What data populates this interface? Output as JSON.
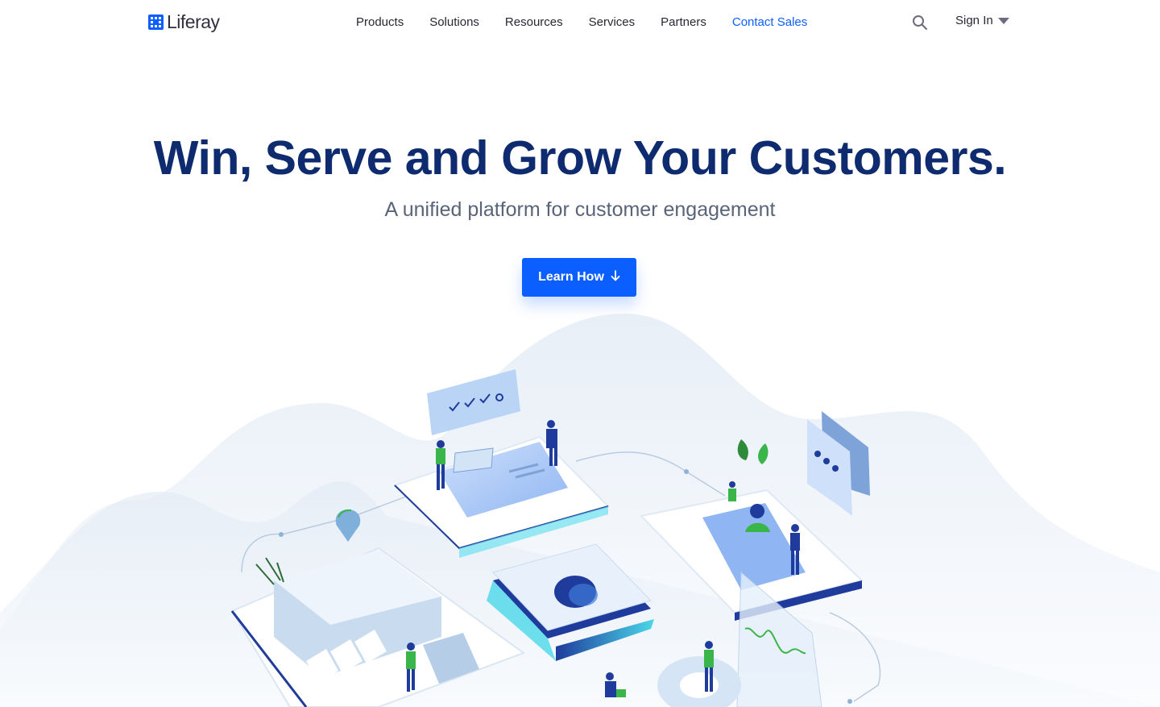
{
  "brand": {
    "name": "Liferay",
    "color": "#0b5fff"
  },
  "nav": {
    "items": [
      {
        "label": "Products"
      },
      {
        "label": "Solutions"
      },
      {
        "label": "Resources"
      },
      {
        "label": "Services"
      },
      {
        "label": "Partners"
      },
      {
        "label": "Contact Sales",
        "accent": true
      }
    ],
    "search_icon": "search-icon",
    "sign_in_label": "Sign In"
  },
  "hero": {
    "title": "Win, Serve and Grow Your Customers.",
    "subtitle": "A unified platform for customer engagement",
    "cta_label": "Learn How",
    "cta_icon": "arrow-down-icon"
  },
  "colors": {
    "primary": "#0b5fff",
    "heading": "#0e2b6f",
    "subtext": "#5a6478",
    "accent_green": "#39b54a",
    "accent_cyan": "#4ad7e8"
  }
}
